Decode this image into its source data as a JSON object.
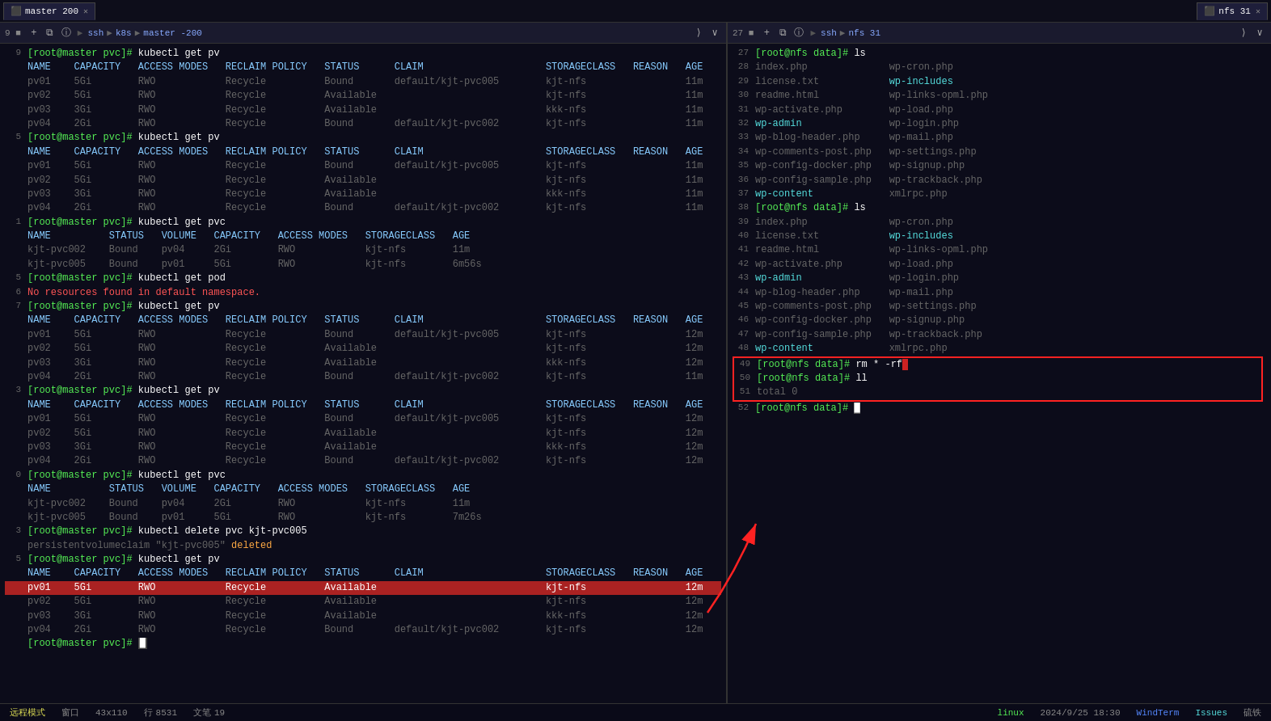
{
  "window": {
    "title": "WindTerm"
  },
  "tabs": [
    {
      "label": "master 200",
      "active": true,
      "session": "ssh k8s master -200"
    },
    {
      "label": "nfs 31",
      "active": true,
      "session": "ssh nfs 31"
    }
  ],
  "left_pane": {
    "session_label": "ssh · k8s · master -200",
    "lines": [
      {
        "num": "9",
        "content": "[root@master pvc]# kubectl get pv",
        "type": "prompt"
      },
      {
        "num": "",
        "content": "NAME    CAPACITY   ACCESS MODES   RECLAIM POLICY   STATUS      CLAIM                     STORAGECLASS   REASON   AGE",
        "type": "header"
      },
      {
        "num": "",
        "content": "pv01    5Gi        RWO            Recycle          Bound       default/kjt-pvc005        kjt-nfs                 11m",
        "type": "data"
      },
      {
        "num": "",
        "content": "pv02    5Gi        RWO            Recycle          Available                             kjt-nfs                 11m",
        "type": "data"
      },
      {
        "num": "",
        "content": "pv03    3Gi        RWO            Recycle          Available                             kkk-nfs                 11m",
        "type": "data"
      },
      {
        "num": "",
        "content": "pv04    2Gi        RWO            Recycle          Bound       default/kjt-pvc002        kjt-nfs                 11m",
        "type": "data"
      },
      {
        "num": "5",
        "content": "[root@master pvc]# kubectl get pv",
        "type": "prompt"
      },
      {
        "num": "",
        "content": "NAME    CAPACITY   ACCESS MODES   RECLAIM POLICY   STATUS      CLAIM                     STORAGECLASS   REASON   AGE",
        "type": "header"
      },
      {
        "num": "",
        "content": "pv01    5Gi        RWO            Recycle          Bound       default/kjt-pvc005        kjt-nfs                 11m",
        "type": "data"
      },
      {
        "num": "",
        "content": "pv02    5Gi        RWO            Recycle          Available                             kjt-nfs                 11m",
        "type": "data"
      },
      {
        "num": "",
        "content": "pv03    3Gi        RWO            Recycle          Available                             kkk-nfs                 11m",
        "type": "data"
      },
      {
        "num": "",
        "content": "pv04    2Gi        RWO            Recycle          Bound       default/kjt-pvc002        kjt-nfs                 11m",
        "type": "data"
      },
      {
        "num": "1",
        "content": "[root@master pvc]# kubectl get pvc",
        "type": "prompt"
      },
      {
        "num": "",
        "content": "NAME          STATUS   VOLUME   CAPACITY   ACCESS MODES   STORAGECLASS   AGE",
        "type": "header"
      },
      {
        "num": "",
        "content": "kjt-pvc002    Bound    pv04     2Gi        RWO            kjt-nfs        11m",
        "type": "data"
      },
      {
        "num": "",
        "content": "kjt-pvc005    Bound    pv01     5Gi        RWO            kjt-nfs        6m56s",
        "type": "data"
      },
      {
        "num": "5",
        "content": "[root@master pvc]# kubectl get pod",
        "type": "prompt"
      },
      {
        "num": "6",
        "content": "No resources found in default namespace.",
        "type": "info"
      },
      {
        "num": "7",
        "content": "[root@master pvc]# kubectl get pv",
        "type": "prompt"
      },
      {
        "num": "",
        "content": "NAME    CAPACITY   ACCESS MODES   RECLAIM POLICY   STATUS      CLAIM                     STORAGECLASS   REASON   AGE",
        "type": "header"
      },
      {
        "num": "",
        "content": "pv01    5Gi        RWO            Recycle          Bound       default/kjt-pvc005        kjt-nfs                 12m",
        "type": "data"
      },
      {
        "num": "",
        "content": "pv02    5Gi        RWO            Recycle          Available                             kjt-nfs                 12m",
        "type": "data"
      },
      {
        "num": "",
        "content": "pv03    3Gi        RWO            Recycle          Available                             kkk-nfs                 12m",
        "type": "data"
      },
      {
        "num": "",
        "content": "pv04    2Gi        RWO            Recycle          Bound       default/kjt-pvc002        kjt-nfs                 11m",
        "type": "data"
      },
      {
        "num": "3",
        "content": "[root@master pvc]# kubectl get pv",
        "type": "prompt"
      },
      {
        "num": "",
        "content": "NAME    CAPACITY   ACCESS MODES   RECLAIM POLICY   STATUS      CLAIM                     STORAGECLASS   REASON   AGE",
        "type": "header"
      },
      {
        "num": "",
        "content": "pv01    5Gi        RWO            Recycle          Bound       default/kjt-pvc005        kjt-nfs                 12m",
        "type": "data"
      },
      {
        "num": "",
        "content": "pv02    5Gi        RWO            Recycle          Available                             kjt-nfs                 12m",
        "type": "data"
      },
      {
        "num": "",
        "content": "pv03    3Gi        RWO            Recycle          Available                             kkk-nfs                 12m",
        "type": "data"
      },
      {
        "num": "",
        "content": "pv04    2Gi        RWO            Recycle          Bound       default/kjt-pvc002        kjt-nfs                 12m",
        "type": "data"
      },
      {
        "num": "0",
        "content": "[root@master pvc]# kubectl get pvc",
        "type": "prompt"
      },
      {
        "num": "",
        "content": "NAME          STATUS   VOLUME   CAPACITY   ACCESS MODES   STORAGECLASS   AGE",
        "type": "header"
      },
      {
        "num": "",
        "content": "kjt-pvc002    Bound    pv04     2Gi        RWO            kjt-nfs        11m",
        "type": "data"
      },
      {
        "num": "",
        "content": "kjt-pvc005    Bound    pv01     5Gi        RWO            kjt-nfs        7m26s",
        "type": "data"
      },
      {
        "num": "3",
        "content": "[root@master pvc]# kubectl delete pvc kjt-pvc005",
        "type": "prompt"
      },
      {
        "num": "",
        "content": "persistentvolumeclaim \"kjt-pvc005\" deleted",
        "type": "info"
      },
      {
        "num": "5",
        "content": "[root@master pvc]# kubectl get pv",
        "type": "prompt"
      },
      {
        "num": "",
        "content": "NAME    CAPACITY   ACCESS MODES   RECLAIM POLICY   STATUS      CLAIM                     STORAGECLASS   REASON   AGE",
        "type": "header"
      },
      {
        "num": "",
        "content": "pv01    5Gi        RWO            Recycle          Available                             kjt-nfs                 12m",
        "type": "highlight"
      },
      {
        "num": "",
        "content": "pv02    5Gi        RWO            Recycle          Available                             kjt-nfs                 12m",
        "type": "data"
      },
      {
        "num": "",
        "content": "pv03    3Gi        RWO            Recycle          Available                             kkk-nfs                 12m",
        "type": "data"
      },
      {
        "num": "",
        "content": "pv04    2Gi        RWO            Recycle          Bound       default/kjt-pvc002        kjt-nfs                 12m",
        "type": "data"
      },
      {
        "num": "",
        "content": "[root@master pvc]#",
        "type": "prompt-end"
      }
    ]
  },
  "right_pane": {
    "session_label": "ssh · nfs 31",
    "lines": [
      {
        "num": "27",
        "content": "[root@nfs data]# ls"
      },
      {
        "num": "28",
        "content": "index.php              wp-cron.php"
      },
      {
        "num": "29",
        "content": "license.txt            wp-includes",
        "cyan": "wp-includes"
      },
      {
        "num": "30",
        "content": "readme.html            wp-links-opml.php"
      },
      {
        "num": "31",
        "content": "wp-activate.php        wp-load.php"
      },
      {
        "num": "32",
        "content": "wp-admin               wp-login.php",
        "cyan": "wp-admin"
      },
      {
        "num": "33",
        "content": "wp-blog-header.php     wp-mail.php"
      },
      {
        "num": "34",
        "content": "wp-comments-post.php   wp-settings.php"
      },
      {
        "num": "35",
        "content": "wp-config-docker.php   wp-signup.php"
      },
      {
        "num": "36",
        "content": "wp-config-sample.php   wp-trackback.php"
      },
      {
        "num": "37",
        "content": "wp-content             xmlrpc.php",
        "cyan": "wp-content"
      },
      {
        "num": "38",
        "content": "[root@nfs data]# ls"
      },
      {
        "num": "39",
        "content": "index.php              wp-cron.php"
      },
      {
        "num": "40",
        "content": "license.txt            wp-includes",
        "cyan": "wp-includes"
      },
      {
        "num": "41",
        "content": "readme.html            wp-links-opml.php"
      },
      {
        "num": "42",
        "content": "wp-activate.php        wp-load.php"
      },
      {
        "num": "43",
        "content": "wp-admin               wp-login.php",
        "cyan": "wp-admin"
      },
      {
        "num": "44",
        "content": "wp-blog-header.php     wp-mail.php"
      },
      {
        "num": "45",
        "content": "wp-comments-post.php   wp-settings.php"
      },
      {
        "num": "46",
        "content": "wp-config-docker.php   wp-signup.php"
      },
      {
        "num": "47",
        "content": "wp-config-sample.php   wp-trackback.php"
      },
      {
        "num": "48",
        "content": "wp-content             xmlrpc.php",
        "cyan": "wp-content"
      },
      {
        "num": "49",
        "content": "[root@nfs data]# rm * -rf",
        "redbox": true
      },
      {
        "num": "50",
        "content": "[root@nfs data]# ll",
        "redbox": true
      },
      {
        "num": "51",
        "content": "total 0",
        "redbox": true
      },
      {
        "num": "52",
        "content": "[root@nfs data]#",
        "cursor": true
      }
    ]
  },
  "status_bar": {
    "mode": "远程模式",
    "window": "窗口",
    "cols_rows": "43x110",
    "row_label": "行",
    "row_val": "8531",
    "col_label": "文笔",
    "col_val": "19",
    "os": "linux",
    "datetime": "2024/9/25 18:30",
    "app": "WindTerm",
    "issues": "Issues",
    "lock": "硫铁"
  }
}
